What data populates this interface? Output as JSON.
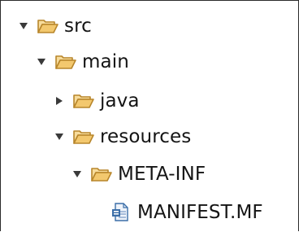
{
  "tree": {
    "nodes": [
      {
        "label": "src",
        "expanded": true,
        "kind": "folder",
        "icon": "folder-open-icon",
        "depth": 0
      },
      {
        "label": "main",
        "expanded": true,
        "kind": "folder",
        "icon": "folder-open-icon",
        "depth": 1
      },
      {
        "label": "java",
        "expanded": false,
        "kind": "folder",
        "icon": "folder-open-icon",
        "depth": 2
      },
      {
        "label": "resources",
        "expanded": true,
        "kind": "folder",
        "icon": "folder-open-icon",
        "depth": 2
      },
      {
        "label": "META-INF",
        "expanded": true,
        "kind": "folder",
        "icon": "folder-open-icon",
        "depth": 3
      },
      {
        "label": "MANIFEST.MF",
        "kind": "file",
        "icon": "manifest-file-icon",
        "depth": 4
      }
    ]
  },
  "colors": {
    "folder_fill": "#f5d28a",
    "folder_stroke": "#b8862b",
    "twisty": "#3a3a3a",
    "text": "#141414",
    "file_blue": "#3b6ea8"
  }
}
